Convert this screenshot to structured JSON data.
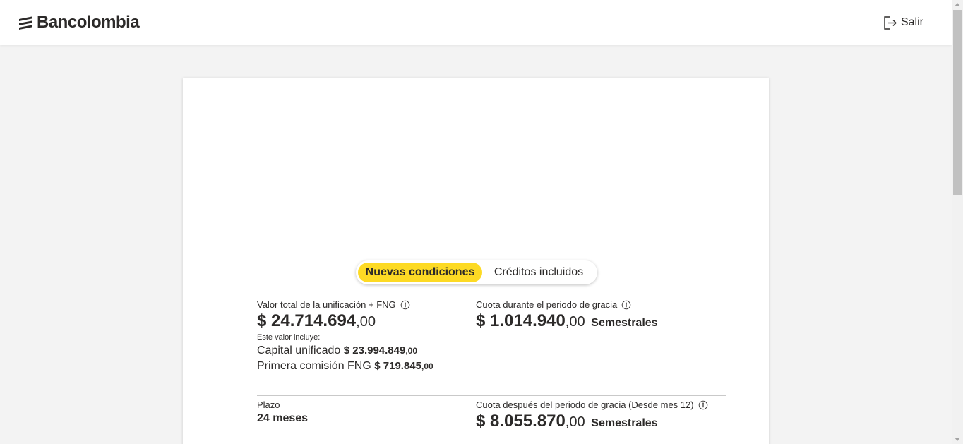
{
  "header": {
    "brand": "Bancolombia",
    "exit_label": "Salir"
  },
  "toggle": {
    "active_label": "Nuevas condiciones",
    "inactive_label": "Créditos incluidos"
  },
  "summary": {
    "total_label": "Valor total de la unificación + FNG",
    "total_int": "$ 24.714.694",
    "total_cents": ",00",
    "includes_label": "Este valor incluye:",
    "capital_label": "Capital unificado",
    "capital_int": "$ 23.994.849",
    "capital_cents": ",00",
    "commission_label": "Primera comisión FNG",
    "commission_int": "$ 719.845",
    "commission_cents": ",00",
    "grace_label": "Cuota durante el periodo de gracia",
    "grace_int": "$ 1.014.940",
    "grace_cents": ",00",
    "grace_unit": "Semestrales",
    "term_label": "Plazo",
    "term_value": "24 meses",
    "after_label": "Cuota después del periodo de gracia (Desde mes 12)",
    "after_int": "$ 8.055.870",
    "after_cents": ",00",
    "after_unit": "Semestrales"
  },
  "colors": {
    "accent": "#fdda24",
    "text": "#2c2a29",
    "background": "#f3f3f3"
  }
}
